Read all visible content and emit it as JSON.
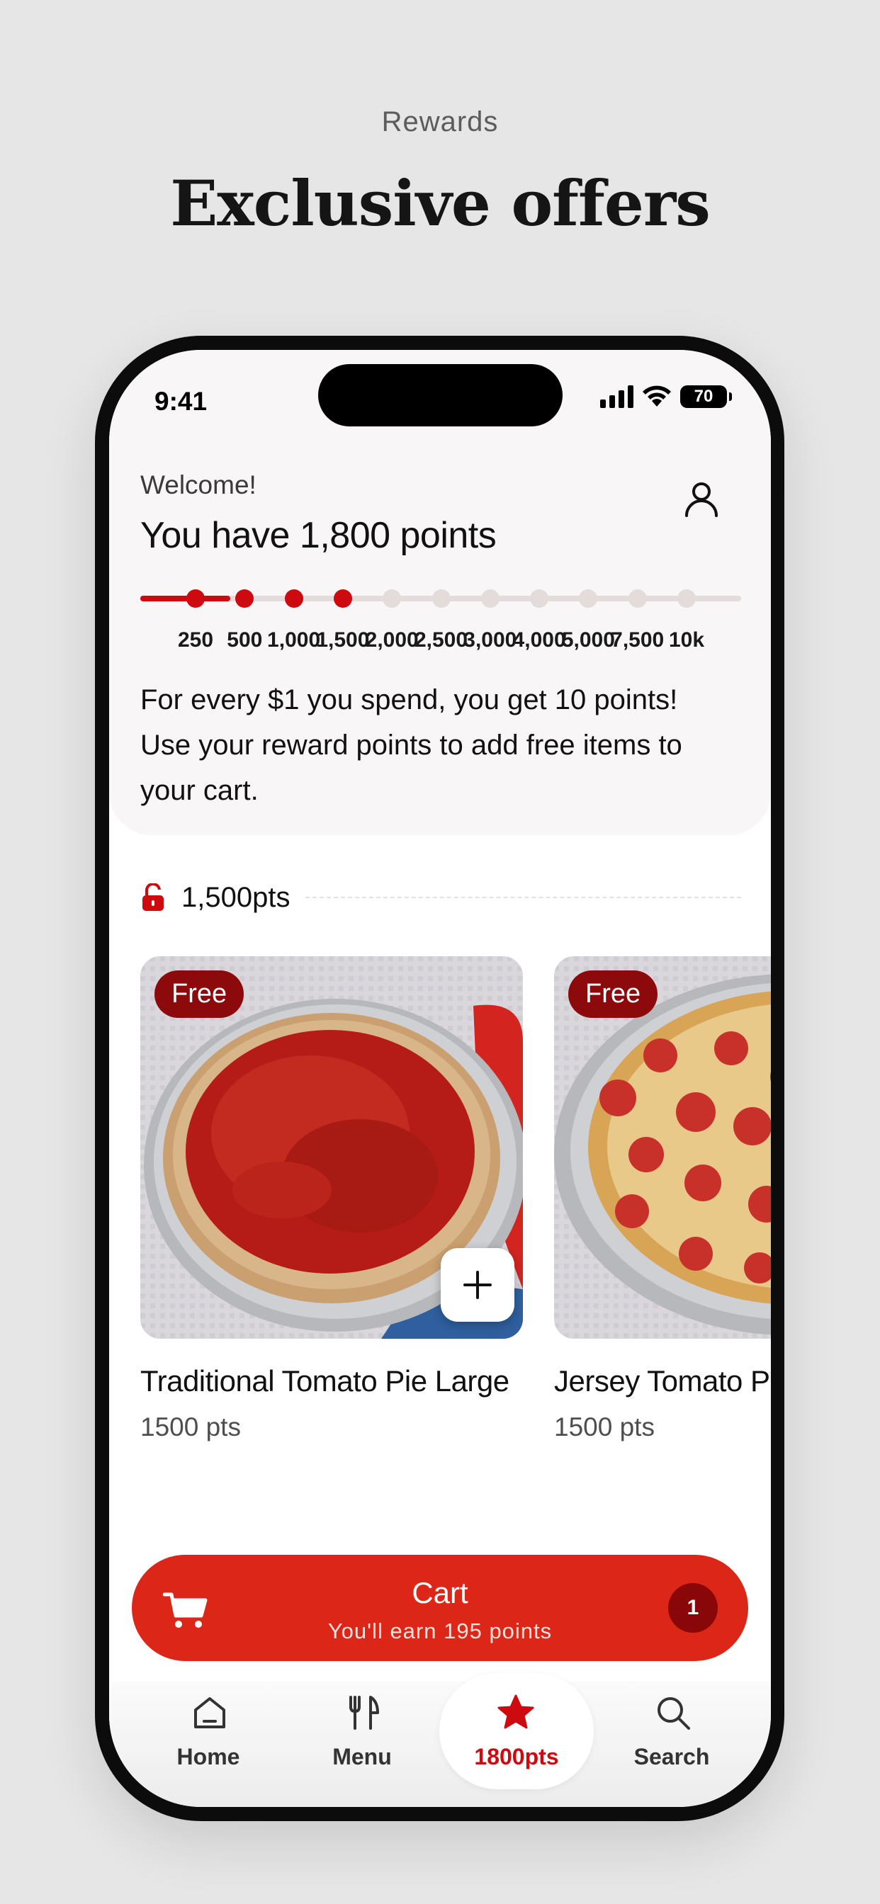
{
  "page": {
    "eyebrow": "Rewards",
    "headline": "Exclusive offers"
  },
  "status_bar": {
    "time": "9:41",
    "battery": "70",
    "icons": [
      "signal-icon",
      "wifi-icon",
      "battery-icon"
    ]
  },
  "header": {
    "welcome": "Welcome!",
    "points_title": "You have 1,800 points",
    "profile_icon": "profile-icon",
    "description": "For every $1 you spend, you get 10 points! Use your reward points to add free items to your cart."
  },
  "progress": {
    "current_points": 1800,
    "fill_fraction": 0.15,
    "milestones": [
      {
        "label": "250",
        "reached": true
      },
      {
        "label": "500",
        "reached": true
      },
      {
        "label": "1,000",
        "reached": true
      },
      {
        "label": "1,500",
        "reached": true
      },
      {
        "label": "2,000",
        "reached": false
      },
      {
        "label": "2,500",
        "reached": false
      },
      {
        "label": "3,000",
        "reached": false
      },
      {
        "label": "4,000",
        "reached": false
      },
      {
        "label": "5,000",
        "reached": false
      },
      {
        "label": "7,500",
        "reached": false
      },
      {
        "label": "10k",
        "reached": false
      }
    ],
    "active_color": "#cc0a10",
    "inactive_color": "#e3dcdb"
  },
  "section": {
    "icon": "unlock-icon",
    "label": "1,500pts"
  },
  "items": [
    {
      "badge": "Free",
      "name": "Traditional Tomato Pie Large",
      "points": "1500 pts",
      "add_icon": "plus-icon"
    },
    {
      "badge": "Free",
      "name": "Jersey Tomato Pie Large",
      "points": "1500 pts"
    }
  ],
  "cart": {
    "icon": "cart-icon",
    "title": "Cart",
    "subtitle": "You'll earn 195 points",
    "count": "1"
  },
  "tabs": [
    {
      "label": "Home",
      "icon": "home-icon",
      "active": false
    },
    {
      "label": "Menu",
      "icon": "fork-knife-icon",
      "active": false
    },
    {
      "label": "1800pts",
      "icon": "star-icon",
      "active": true
    },
    {
      "label": "Search",
      "icon": "search-icon",
      "active": false
    }
  ],
  "colors": {
    "brand_red": "#dc2617",
    "dark_red": "#8c0a0c",
    "background": "#e6e6e7"
  }
}
